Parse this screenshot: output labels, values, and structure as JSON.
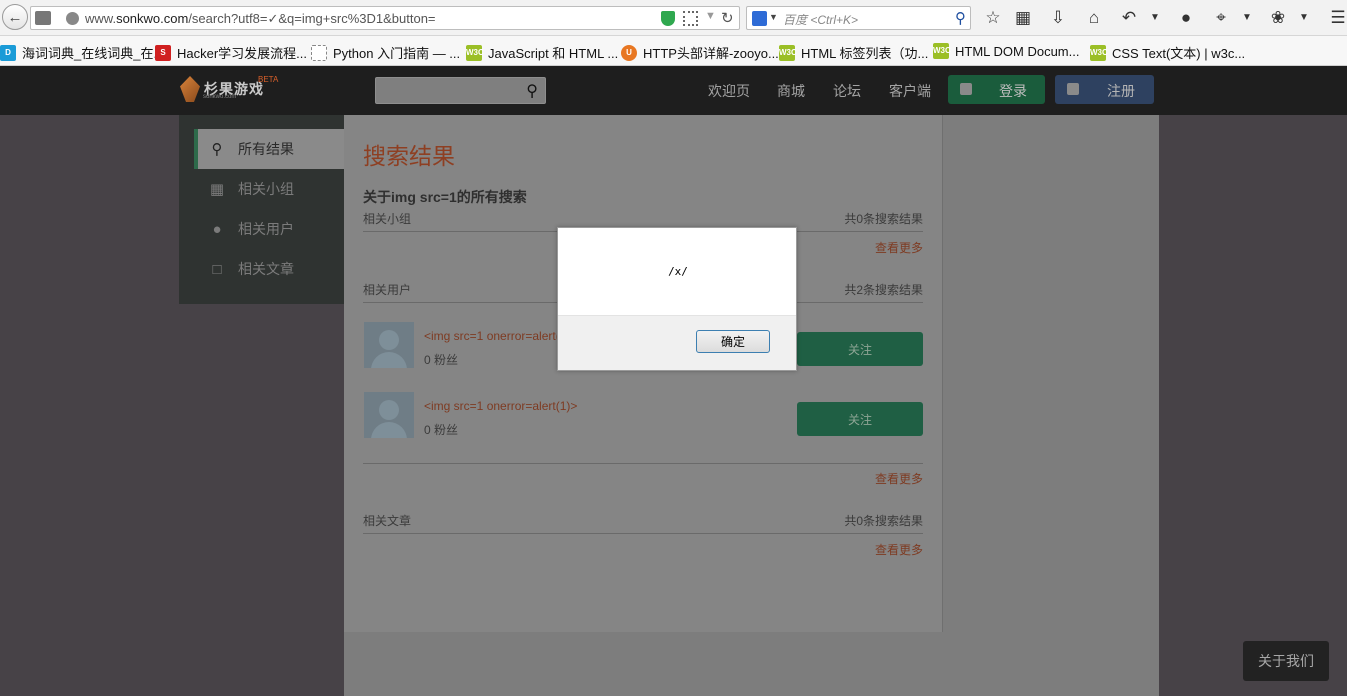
{
  "browser": {
    "url_prefix": "www.",
    "url_domain": "sonkwo.com",
    "url_path": "/search?utf8=✓&q=img+src%3D1&button=",
    "search_placeholder": "百度 <Ctrl+K>"
  },
  "bookmarks": [
    {
      "label": "海词词典_在线词典_在...",
      "icon_color": "#1a9bd7"
    },
    {
      "label": "Hacker学习发展流程...",
      "icon_color": "#d02020"
    },
    {
      "label": "Python 入门指南 — ...",
      "icon_color": "#ffffff"
    },
    {
      "label": "JavaScript 和 HTML ...",
      "icon_color": "#9bbf26"
    },
    {
      "label": "HTTP头部详解-zooyo...",
      "icon_color": "#e87722"
    },
    {
      "label": "HTML 标签列表（功...",
      "icon_color": "#9bbf26"
    },
    {
      "label": "HTML DOM Docum...",
      "icon_color": "#9bbf26"
    },
    {
      "label": "CSS Text(文本) | w3c...",
      "icon_color": "#9bbf26"
    }
  ],
  "site": {
    "logo_text": "杉果游戏",
    "logo_sub": "sonkwo.com",
    "logo_badge": "BETA",
    "nav": [
      "欢迎页",
      "商城",
      "论坛",
      "客户端"
    ],
    "login_label": "登录",
    "register_label": "注册",
    "sidebar": [
      {
        "label": "所有结果",
        "icon": "search-icon",
        "active": true
      },
      {
        "label": "相关小组",
        "icon": "grid-icon",
        "active": false
      },
      {
        "label": "相关用户",
        "icon": "users-icon",
        "active": false
      },
      {
        "label": "相关文章",
        "icon": "document-icon",
        "active": false
      }
    ],
    "title": "搜索结果",
    "subtitle": "关于img src=1的所有搜索",
    "sections": {
      "groups": {
        "label": "相关小组",
        "count": "共0条搜索结果",
        "more": "查看更多"
      },
      "users": {
        "label": "相关用户",
        "count": "共2条搜索结果",
        "more": "查看更多"
      },
      "articles": {
        "label": "相关文章",
        "count": "共0条搜索结果",
        "more": "查看更多"
      }
    },
    "users": [
      {
        "name": "<img src=1 onerror=alert(1)>",
        "fans": "0 粉丝",
        "follow": "关注"
      },
      {
        "name": "<img src=1 onerror=alert(1)>",
        "fans": "0 粉丝",
        "follow": "关注"
      }
    ],
    "about_label": "关于我们"
  },
  "dialog": {
    "message": "/x/",
    "ok_label": "确定"
  }
}
